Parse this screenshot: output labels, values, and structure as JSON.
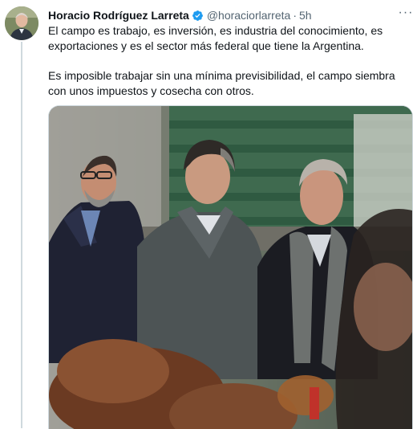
{
  "tweet": {
    "author_name": "Horacio Rodríguez Larreta",
    "handle": "@horaciorlarreta",
    "separator": "·",
    "time": "5h",
    "more_label": "···",
    "paragraphs": [
      "El campo es trabajo, es inversión, es industria del conocimiento, es exportaciones y es el sector más federal que tiene la Argentina.",
      "Es imposible trabajar sin una mínima previsibilidad, el campo siembra con unos impuestos y cosecha con otros."
    ]
  },
  "icons": {
    "verified": "verified-badge-icon",
    "more": "more-options-icon"
  },
  "colors": {
    "verified_blue": "#1d9bf0",
    "secondary_text": "#536471",
    "rail": "#cfd9de"
  }
}
